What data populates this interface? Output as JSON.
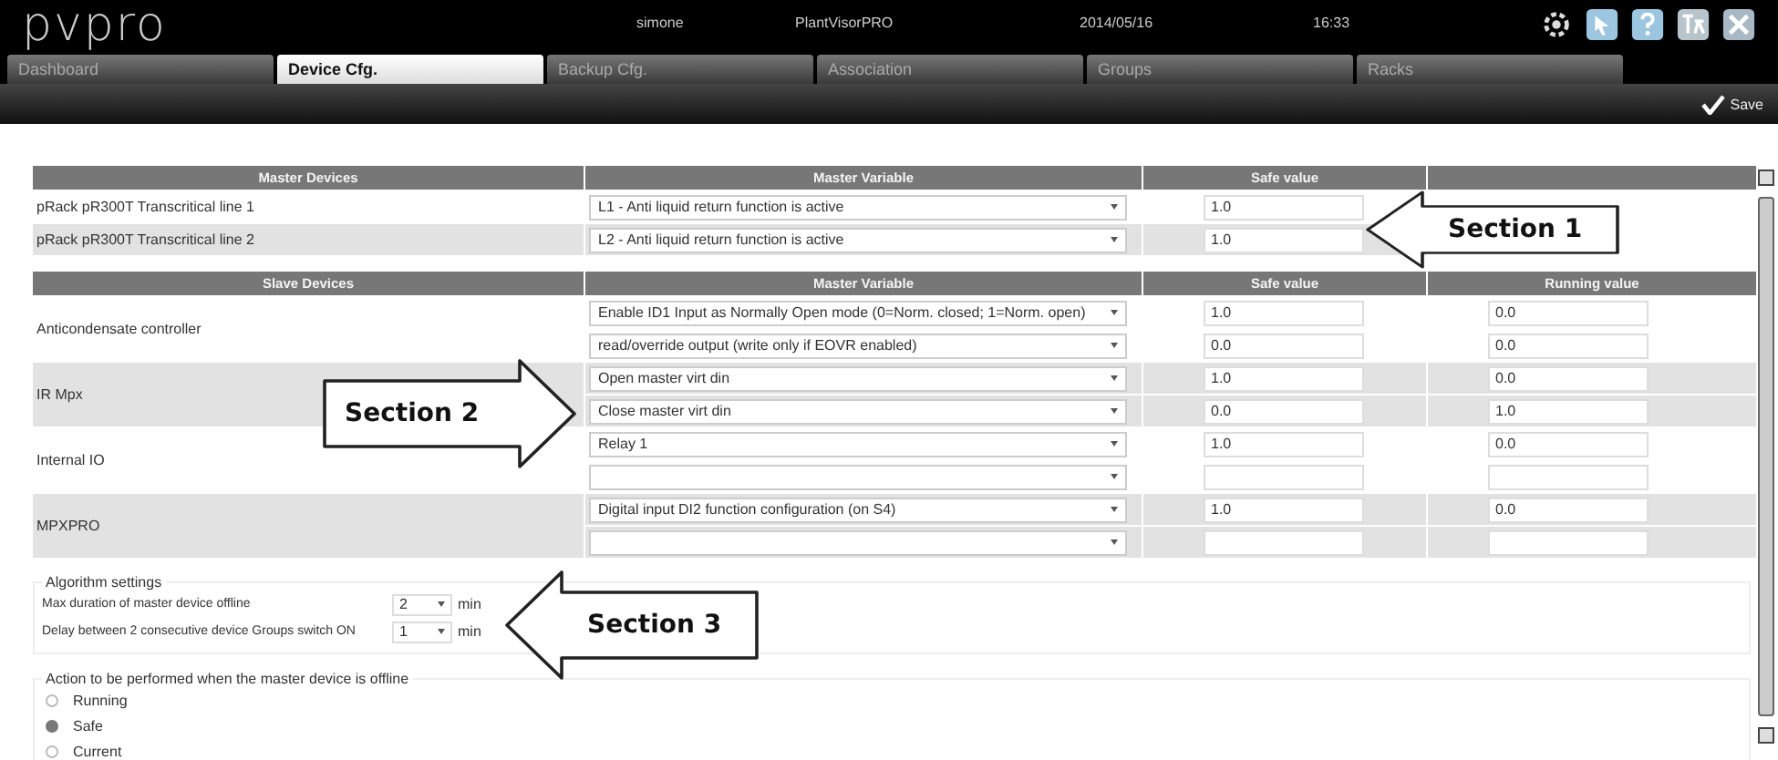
{
  "header": {
    "logo": "pvpro",
    "user": "simone",
    "application": "PlantVisorPRO",
    "date": "2014/05/16",
    "time": "16:33"
  },
  "tabs": [
    {
      "label": "Dashboard",
      "selected": false
    },
    {
      "label": "Device Cfg.",
      "selected": true
    },
    {
      "label": "Backup Cfg.",
      "selected": false
    },
    {
      "label": "Association",
      "selected": false
    },
    {
      "label": "Groups",
      "selected": false
    },
    {
      "label": "Racks",
      "selected": false
    }
  ],
  "save_button": "Save",
  "master_table": {
    "columns": [
      "Master Devices",
      "Master Variable",
      "Safe value"
    ],
    "rows": [
      {
        "device": "pRack pR300T Transcritical line 1",
        "variable": "L1 - Anti liquid return function is active",
        "safe_value": "1.0"
      },
      {
        "device": "pRack pR300T Transcritical line 2",
        "variable": "L2 - Anti liquid return function is active",
        "safe_value": "1.0"
      }
    ]
  },
  "slave_table": {
    "columns": [
      "Slave Devices",
      "Master Variable",
      "Safe value",
      "Running value"
    ],
    "groups": [
      {
        "device": "Anticondensate controller",
        "rows": [
          {
            "variable": "Enable ID1 Input as Normally Open mode (0=Norm. closed; 1=Norm. open)",
            "safe_value": "1.0",
            "running_value": "0.0"
          },
          {
            "variable": "read/override output (write only if EOVR enabled)",
            "safe_value": "0.0",
            "running_value": "0.0"
          }
        ]
      },
      {
        "device": "IR Mpx",
        "rows": [
          {
            "variable": "Open master virt din",
            "safe_value": "1.0",
            "running_value": "0.0"
          },
          {
            "variable": "Close master virt din",
            "safe_value": "0.0",
            "running_value": "1.0"
          }
        ]
      },
      {
        "device": "Internal IO",
        "rows": [
          {
            "variable": "Relay 1",
            "safe_value": "1.0",
            "running_value": "0.0"
          },
          {}
        ]
      },
      {
        "device": "MPXPRO",
        "rows": [
          {
            "variable": "Digital input DI2 function configuration (on S4)",
            "safe_value": "1.0",
            "running_value": "0.0"
          },
          {}
        ]
      }
    ]
  },
  "algorithm_settings": {
    "legend": "Algorithm settings",
    "settings": [
      {
        "label": "Max duration of master device offline",
        "value": "2",
        "unit": "min"
      },
      {
        "label": "Delay between 2 consecutive device Groups switch ON",
        "value": "1",
        "unit": "min"
      }
    ]
  },
  "offline_action": {
    "legend": "Action to be performed when the master device is offline",
    "options": [
      {
        "label": "Running",
        "selected": false
      },
      {
        "label": "Safe",
        "selected": true
      },
      {
        "label": "Current",
        "selected": false
      }
    ]
  },
  "callouts": [
    {
      "label": "Section 1",
      "kind": "left"
    },
    {
      "label": "Section 2",
      "kind": "right"
    },
    {
      "label": "Section 3",
      "kind": "left"
    }
  ]
}
